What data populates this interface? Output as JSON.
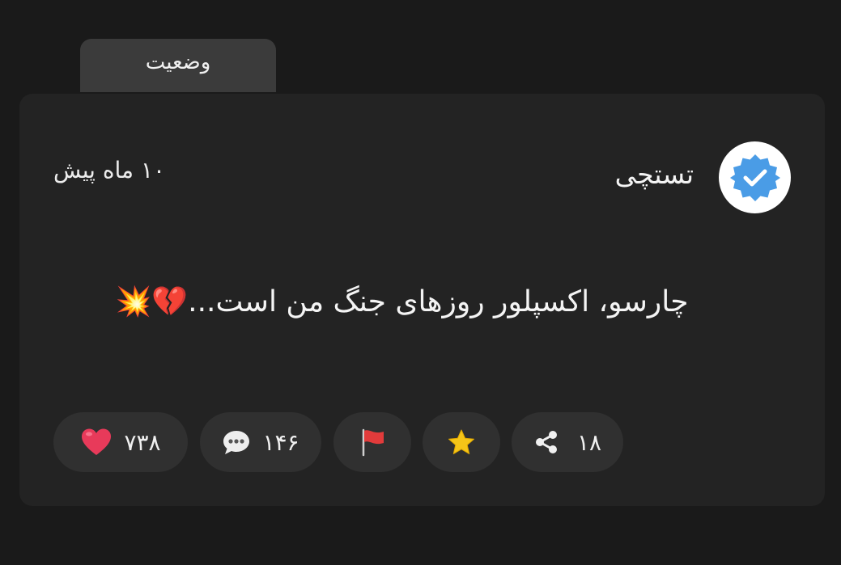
{
  "tab": {
    "label": "وضعیت"
  },
  "post": {
    "author": "تستچی",
    "time": "۱۰ ماه پیش",
    "text": "چارسو، اکسپلور روزهای جنگ من است...",
    "emojis": "💔💥"
  },
  "actions": {
    "likes": "۷۳۸",
    "comments": "۱۴۶",
    "shares": "۱۸"
  },
  "colors": {
    "background": "#1a1a1a",
    "card": "#232323",
    "pill": "#303030",
    "verified_badge": "#4a9ce6",
    "heart": "#e83a5a",
    "star": "#f5c518",
    "flag": "#e23b3b"
  },
  "icons": {
    "verified": "verified-badge-icon",
    "like": "heart-icon",
    "comment": "speech-bubble-icon",
    "report": "flag-icon",
    "favorite": "star-icon",
    "share": "share-icon"
  }
}
